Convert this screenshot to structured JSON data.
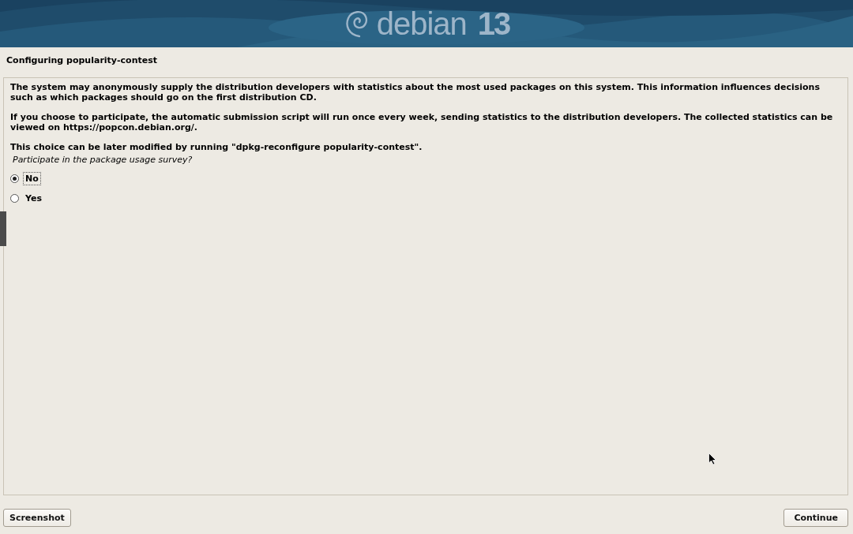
{
  "banner": {
    "logo_text": "debian",
    "version": "13"
  },
  "title": "Configuring popularity-contest",
  "paragraphs": [
    "The system may anonymously supply the distribution developers with statistics about the most used packages on this system. This information influences decisions such as which packages should go on the first distribution CD.",
    "If you choose to participate, the automatic submission script will run once every week, sending statistics to the distribution developers. The collected statistics can be viewed on https://popcon.debian.org/.",
    "This choice can be later modified by running \"dpkg-reconfigure popularity-contest\"."
  ],
  "question": "Participate in the package usage survey?",
  "options": [
    {
      "label": "No",
      "selected": true
    },
    {
      "label": "Yes",
      "selected": false
    }
  ],
  "buttons": {
    "left": "Screenshot",
    "right": "Continue"
  }
}
